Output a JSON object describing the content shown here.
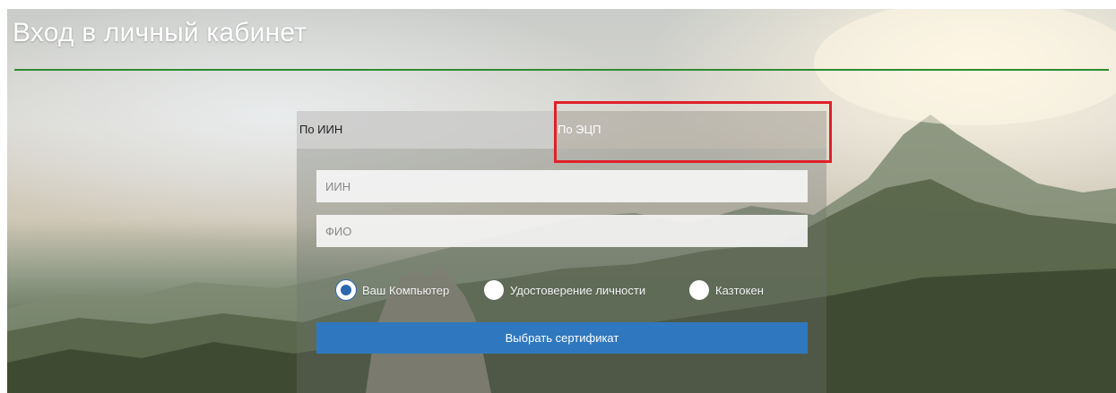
{
  "page": {
    "title": "Вход в личный кабинет"
  },
  "tabs": [
    {
      "label": "По ИИН",
      "active": false
    },
    {
      "label": "По ЭЦП",
      "active": true
    }
  ],
  "form": {
    "iin_placeholder": "ИИН",
    "fio_placeholder": "ФИО",
    "radio_options": [
      {
        "label": "Ваш Компьютер",
        "checked": true
      },
      {
        "label": "Удостоверение личности",
        "checked": false
      },
      {
        "label": "Казтокен",
        "checked": false
      }
    ],
    "submit_label": "Выбрать сертификат"
  },
  "colors": {
    "title_rule": "#2e8b2e",
    "button": "#2f78bf",
    "highlight": "#e0202a",
    "radio_checked": "#2c67b0"
  }
}
